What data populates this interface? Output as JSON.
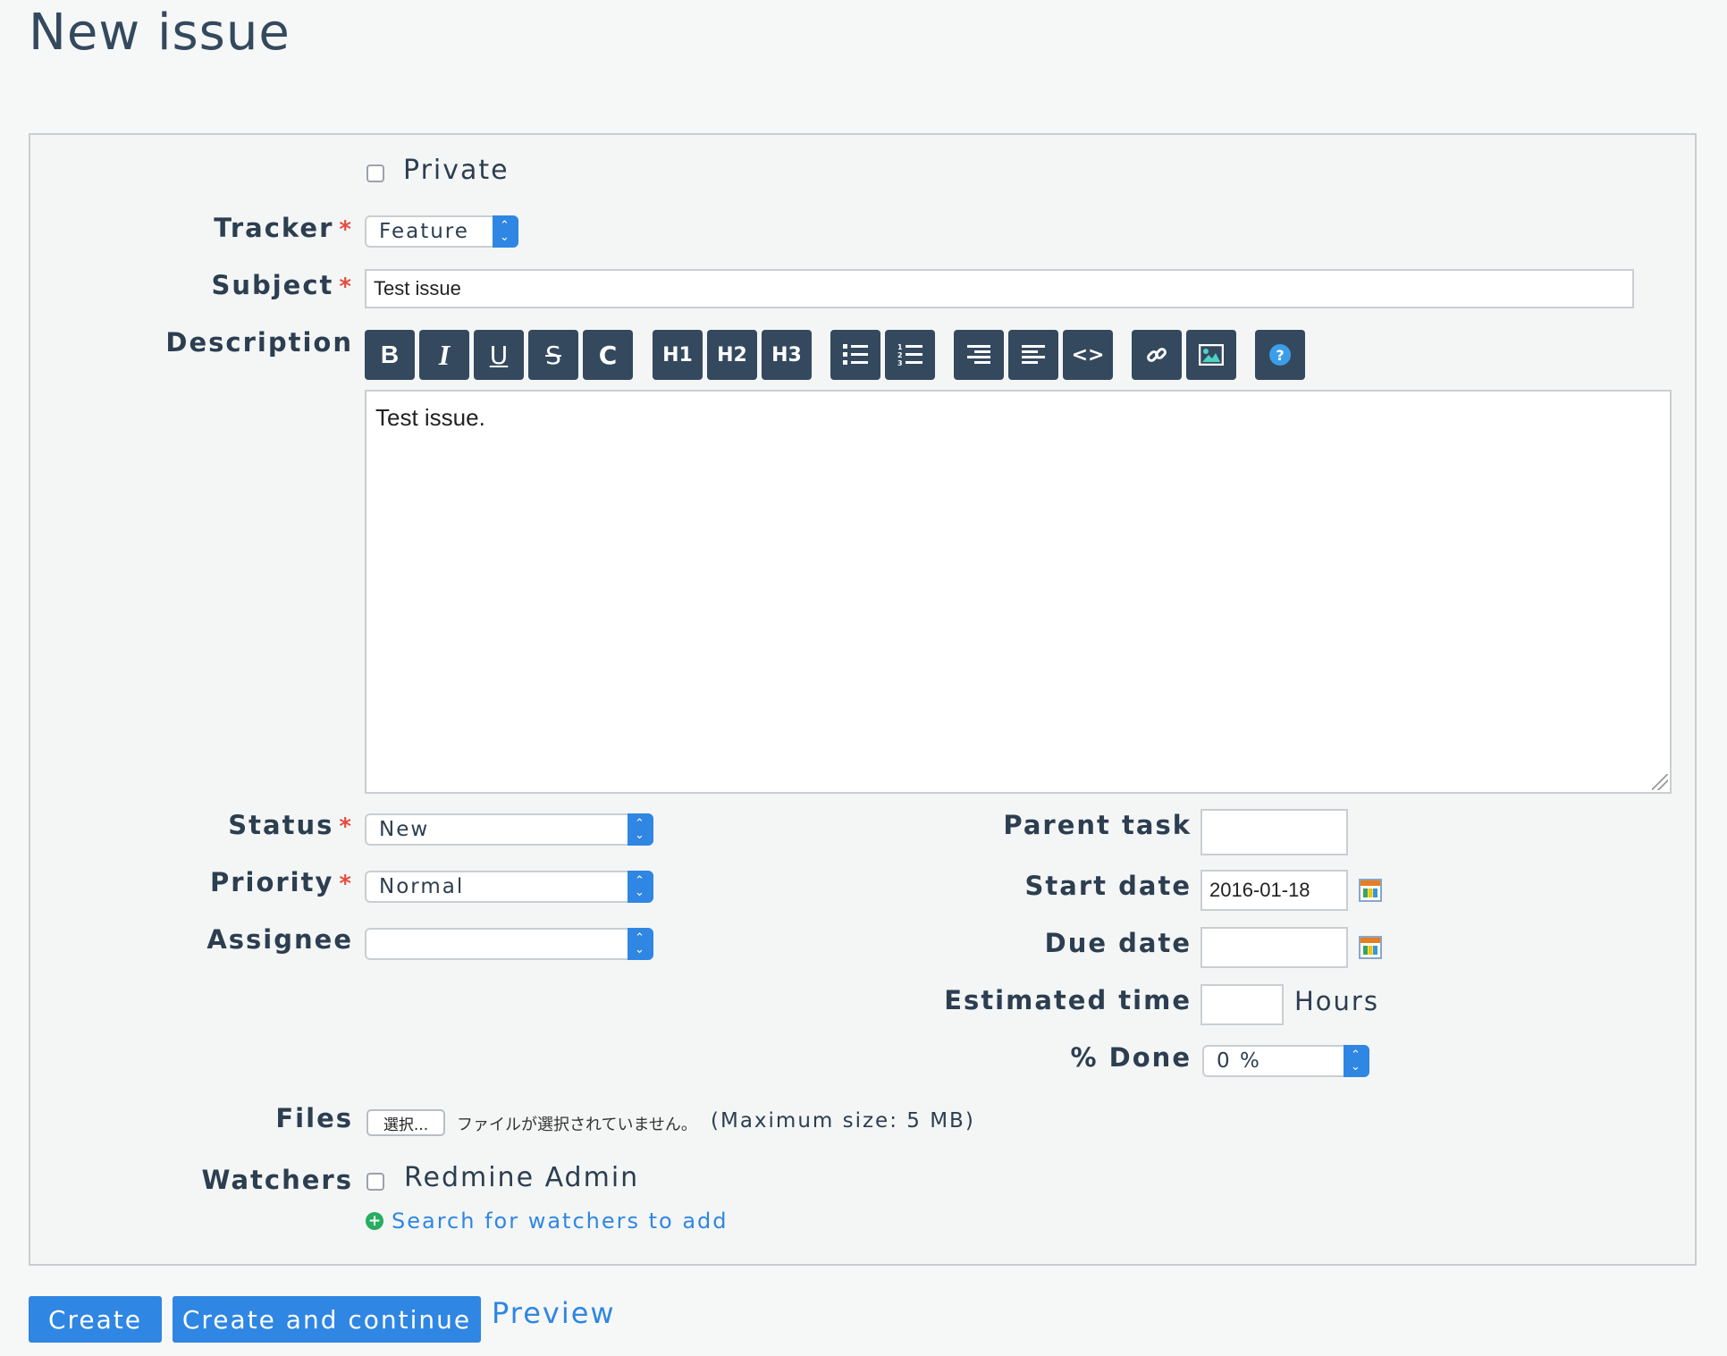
{
  "page": {
    "title": "New issue"
  },
  "form": {
    "private_label": "Private",
    "tracker": {
      "label": "Tracker",
      "value": "Feature"
    },
    "subject": {
      "label": "Subject",
      "value": "Test issue"
    },
    "description": {
      "label": "Description",
      "value": "Test issue.",
      "toolbar": {
        "bold": "B",
        "italic": "I",
        "underline": "U",
        "strike": "S",
        "code_inline": "C",
        "h1": "H1",
        "h2": "H2",
        "h3": "H3",
        "code_block": "<>",
        "help": "?"
      }
    },
    "status": {
      "label": "Status",
      "value": "New"
    },
    "priority": {
      "label": "Priority",
      "value": "Normal"
    },
    "assignee": {
      "label": "Assignee",
      "value": ""
    },
    "parent_task": {
      "label": "Parent task",
      "value": ""
    },
    "start_date": {
      "label": "Start date",
      "value": "2016-01-18"
    },
    "due_date": {
      "label": "Due date",
      "value": ""
    },
    "estimated_time": {
      "label": "Estimated time",
      "value": "",
      "unit": "Hours"
    },
    "done": {
      "label": "% Done",
      "value": "0 %"
    },
    "files": {
      "label": "Files",
      "button": "選択...",
      "no_file": "ファイルが選択されていません。",
      "max_size": "(Maximum size: 5 MB)"
    },
    "watchers": {
      "label": "Watchers",
      "user": "Redmine Admin",
      "search_link": "Search for watchers to add"
    },
    "required_mark": "*"
  },
  "actions": {
    "create": "Create",
    "create_continue": "Create and continue",
    "preview": "Preview"
  },
  "colors": {
    "accent": "#2f86e3",
    "toolbar": "#34495e",
    "required": "#e74c3c",
    "add_icon": "#27ae60"
  }
}
